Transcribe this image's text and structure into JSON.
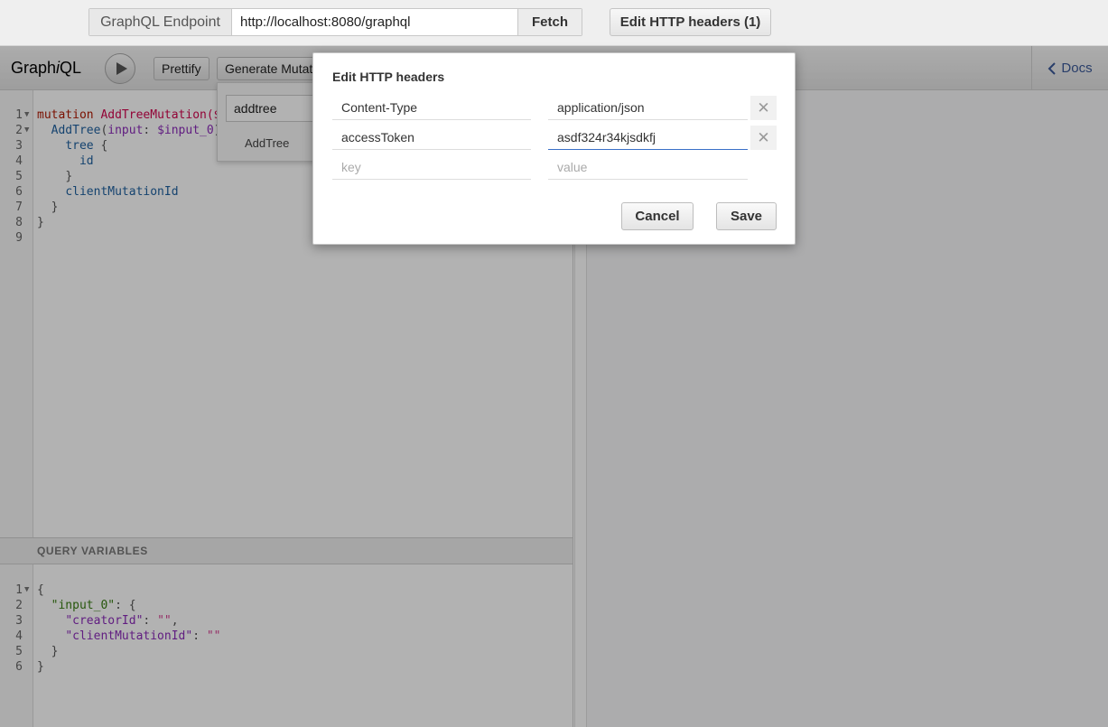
{
  "endpoint": {
    "label": "GraphQL Endpoint",
    "url": "http://localhost:8080/graphql",
    "fetch_label": "Fetch",
    "edit_headers_label": "Edit HTTP headers (1)"
  },
  "toolbar": {
    "title_pre": "Graph",
    "title_i": "i",
    "title_post": "QL",
    "prettify_label": "Prettify",
    "generate_label": "Generate Mutation",
    "docs_label": "Docs"
  },
  "query_editor": {
    "lines": [
      {
        "n": "1",
        "fold": true
      },
      {
        "n": "2",
        "fold": true
      },
      {
        "n": "3"
      },
      {
        "n": "4"
      },
      {
        "n": "5"
      },
      {
        "n": "6"
      },
      {
        "n": "7"
      },
      {
        "n": "8"
      },
      {
        "n": "9"
      }
    ],
    "code": {
      "l1_kw": "mutation",
      "l1_name": "AddTreeMutation($",
      "l2_fn": "AddTree",
      "l2_open": "(",
      "l2_arg": "input",
      "l2_colon": ": ",
      "l2_var": "$input_0",
      "l2_close": ")",
      "l3_field": "tree",
      "l3_brace": " {",
      "l4_field": "id",
      "l5": "}",
      "l6_field": "clientMutationId",
      "l7": "}",
      "l8": "}"
    }
  },
  "variables": {
    "header": "QUERY VARIABLES",
    "lines": [
      {
        "n": "1",
        "fold": true
      },
      {
        "n": "2"
      },
      {
        "n": "3"
      },
      {
        "n": "4"
      },
      {
        "n": "5"
      },
      {
        "n": "6"
      }
    ],
    "code": {
      "l1": "{",
      "l2_key": "\"input_0\"",
      "l2_rest": ": {",
      "l3_key": "\"creatorId\"",
      "l3_colon": ": ",
      "l3_val": "\"\"",
      "l3_comma": ",",
      "l4_key": "\"clientMutationId\"",
      "l4_colon": ": ",
      "l4_val": "\"\"",
      "l5": "}",
      "l6": "}"
    }
  },
  "autocomplete": {
    "input_value": "addtree",
    "item": "AddTree"
  },
  "modal": {
    "title": "Edit HTTP headers",
    "headers": [
      {
        "key": "Content-Type",
        "value": "application/json"
      },
      {
        "key": "accessToken",
        "value": "asdf324r34kjsdkfj"
      }
    ],
    "new_row": {
      "key_placeholder": "key",
      "value_placeholder": "value"
    },
    "cancel_label": "Cancel",
    "save_label": "Save",
    "delete_glyph": "✕"
  }
}
